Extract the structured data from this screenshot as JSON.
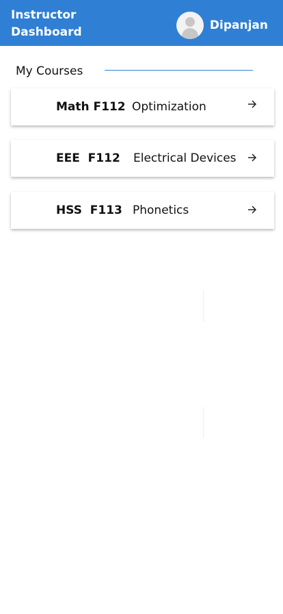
{
  "header": {
    "title": "Instructor Dashboard",
    "user_name": "Dipanjan",
    "background_color": "#2f7fd4",
    "avatar_icon": "user-avatar-icon"
  },
  "section": {
    "title": "My Courses"
  },
  "courses": [
    {
      "code": "Math F112",
      "name": "Optimization",
      "icon": "arrow-right-icon"
    },
    {
      "code": "EEE  F112",
      "name": "Electrical Devices",
      "icon": "arrow-right-icon"
    },
    {
      "code": "HSS  F113",
      "name": "Phonetics",
      "icon": "arrow-right-icon"
    }
  ]
}
